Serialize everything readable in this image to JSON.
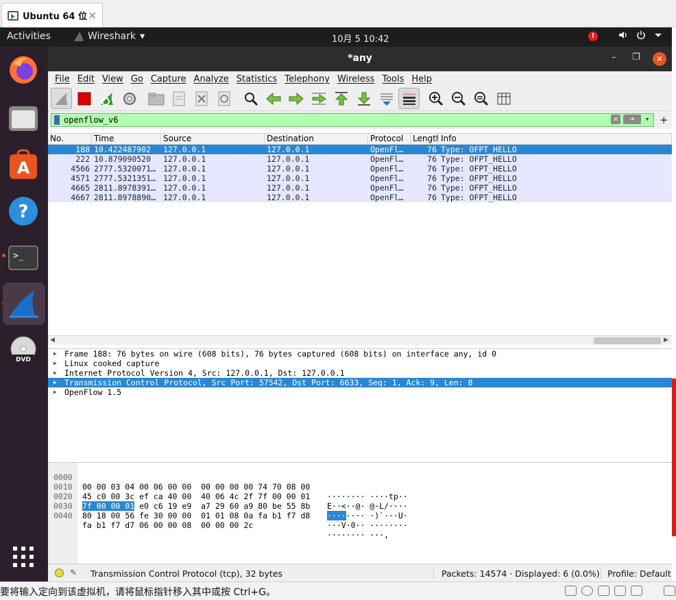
{
  "vm_tab": {
    "title": "Ubuntu 64 位",
    "close": "✕"
  },
  "topbar": {
    "activities": "Activities",
    "app_name": "Wireshark",
    "app_caret": "▾",
    "clock": "10月 5  10:42",
    "alert": "!"
  },
  "window": {
    "title": "*any",
    "minimize": "–",
    "restore": "❐",
    "close": "✕"
  },
  "menu": [
    "File",
    "Edit",
    "View",
    "Go",
    "Capture",
    "Analyze",
    "Statistics",
    "Telephony",
    "Wireless",
    "Tools",
    "Help"
  ],
  "filter": {
    "value": "openflow_v6",
    "plus": "+"
  },
  "packet_list": {
    "columns": [
      "No.",
      "Time",
      "Source",
      "Destination",
      "Protocol",
      "Length",
      "Info"
    ],
    "rows": [
      {
        "no": "188",
        "time": "10.422487902",
        "src": "127.0.0.1",
        "dst": "127.0.0.1",
        "proto": "OpenFl…",
        "len": "76",
        "info": "Type: OFPT_HELLO"
      },
      {
        "no": "222",
        "time": "10.879090520",
        "src": "127.0.0.1",
        "dst": "127.0.0.1",
        "proto": "OpenFl…",
        "len": "76",
        "info": "Type: OFPT_HELLO"
      },
      {
        "no": "4566",
        "time": "2777.5320071…",
        "src": "127.0.0.1",
        "dst": "127.0.0.1",
        "proto": "OpenFl…",
        "len": "76",
        "info": "Type: OFPT_HELLO"
      },
      {
        "no": "4571",
        "time": "2777.5321351…",
        "src": "127.0.0.1",
        "dst": "127.0.0.1",
        "proto": "OpenFl…",
        "len": "76",
        "info": "Type: OFPT_HELLO"
      },
      {
        "no": "4665",
        "time": "2811.8978391…",
        "src": "127.0.0.1",
        "dst": "127.0.0.1",
        "proto": "OpenFl…",
        "len": "76",
        "info": "Type: OFPT_HELLO"
      },
      {
        "no": "4667",
        "time": "2811.8978890…",
        "src": "127.0.0.1",
        "dst": "127.0.0.1",
        "proto": "OpenFl…",
        "len": "76",
        "info": "Type: OFPT_HELLO"
      }
    ]
  },
  "details": [
    "Frame 188: 76 bytes on wire (608 bits), 76 bytes captured (608 bits) on interface any, id 0",
    "Linux cooked capture",
    "Internet Protocol Version 4, Src: 127.0.0.1, Dst: 127.0.0.1",
    "Transmission Control Protocol, Src Port: 57542, Dst Port: 6633, Seq: 1, Ack: 9, Len: 8",
    "OpenFlow 1.5"
  ],
  "bytes": [
    {
      "off": "0000",
      "hex": "00 00 03 04 00 06 00 00  00 00 00 00 74 70 08 00",
      "asc": "········ ····tp··"
    },
    {
      "off": "0010",
      "hex": "45 c0 00 3c ef ca 40 00  40 06 4c 2f 7f 00 00 01",
      "asc": "E··<··@· @·L/····"
    },
    {
      "off": "0020",
      "hex_hl": "7f 00 00 01",
      "hex_rest": " e0 c6 19 e9  a7 29 60 a9 80 be 55 8b",
      "asc_hl": "····",
      "asc_rest": "···· ·)`···U·"
    },
    {
      "off": "0030",
      "hex": "80 18 00 56 fe 30 00 00  01 01 08 0a fa b1 f7 d8",
      "asc": "···V·0·· ········"
    },
    {
      "off": "0040",
      "hex": "fa b1 f7 d7 06 00 00 08  00 00 00 2c",
      "asc": "········ ···,"
    }
  ],
  "status": {
    "left": "Transmission Control Protocol (tcp), 32 bytes",
    "packets": "Packets: 14574 · Displayed: 6 (0.0%)",
    "profile": "Profile: Default"
  },
  "vm_bottom": {
    "message": "要将输入定向到该虚拟机，请将鼠标指针移入其中或按 Ctrl+G。"
  }
}
